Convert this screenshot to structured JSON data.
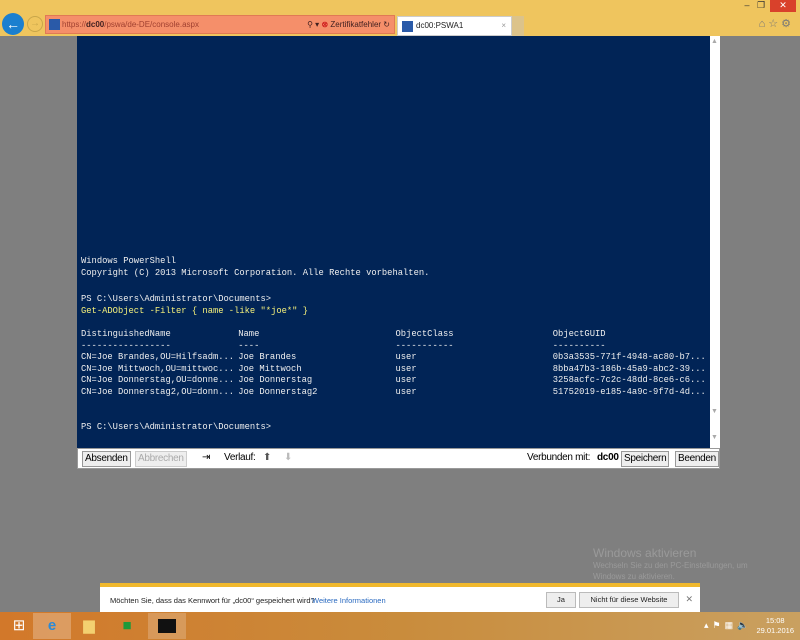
{
  "browser": {
    "url_prefix": "https://",
    "url_host": "dc00",
    "url_path": "/pswa/de-DE/console.aspx",
    "cert_error": "Zertifikatfehler",
    "tab_title": "dc00:PSWA1"
  },
  "console": {
    "lines_top": [
      "Windows PowerShell",
      "Copyright (C) 2013 Microsoft Corporation. Alle Rechte vorbehalten.",
      "",
      " PS C:\\Users\\Administrator\\Documents>"
    ],
    "prompt": "PS C:\\Users\\Administrator\\Documents>",
    "command": "Get-ADObject -Filter { name -like \"*joe*\" }",
    "columns": [
      "DistinguishedName",
      "Name",
      "ObjectClass",
      "ObjectGUID"
    ],
    "separators": [
      "-----------------",
      "----",
      "-----------",
      "----------"
    ],
    "rows": [
      [
        "CN=Joe Brandes,OU=Hilfsadm...",
        "Joe Brandes",
        "user",
        "0b3a3535-771f-4948-ac80-b7..."
      ],
      [
        "CN=Joe Mittwoch,OU=mittwoc...",
        "Joe Mittwoch",
        "user",
        "8bba47b3-186b-45a9-abc2-39..."
      ],
      [
        "CN=Joe Donnerstag,OU=donne...",
        "Joe Donnerstag",
        "user",
        "3258acfc-7c2c-48dd-8ce6-c6..."
      ],
      [
        "CN=Joe Donnerstag2,OU=donn...",
        "Joe Donnerstag2",
        "user",
        "51752019-e185-4a9c-9f7d-4d..."
      ]
    ]
  },
  "toolbar": {
    "submit": "Absenden",
    "cancel": "Abbrechen",
    "history": "Verlauf:",
    "connected": "Verbunden mit:",
    "host": "dc00",
    "save": "Speichern",
    "exit": "Beenden"
  },
  "notification": {
    "text": "Möchten Sie, dass das Kennwort für „dc00“ gespeichert wird?",
    "link": "Weitere Informationen",
    "yes": "Ja",
    "no": "Nicht für diese Website"
  },
  "watermark": {
    "title": "Windows aktivieren",
    "line1": "Wechseln Sie zu den PC-Einstellungen, um",
    "line2": "Windows zu aktivieren."
  },
  "clock": {
    "time": "15:08",
    "date": "29.01.2016"
  }
}
